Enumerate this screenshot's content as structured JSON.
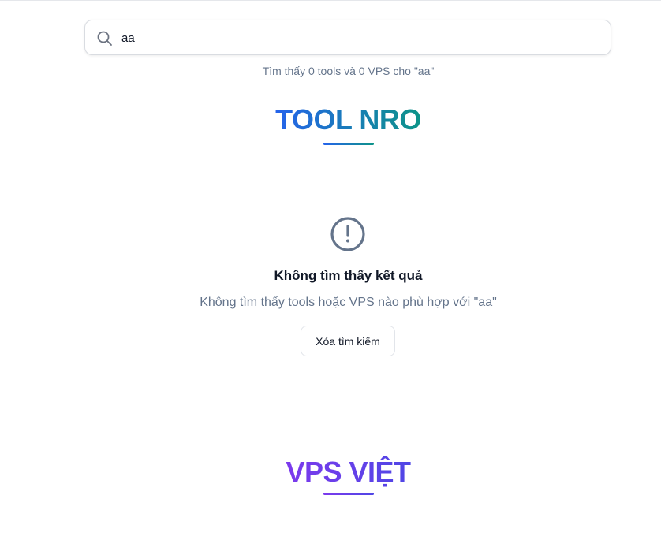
{
  "search": {
    "value": "aa",
    "icon": "search-icon"
  },
  "results_summary": "Tìm thấy 0 tools và 0 VPS cho \"aa\"",
  "tool_section": {
    "title": "TOOL NRO",
    "accent_from": "#2563eb",
    "accent_to": "#0d9488"
  },
  "empty_state": {
    "icon": "alert-circle-icon",
    "title": "Không tìm thấy kết quả",
    "description": "Không tìm thấy tools hoặc VPS nào phù hợp với \"aa\"",
    "clear_button_label": "Xóa tìm kiếm"
  },
  "vps_section": {
    "title": "VPS VIỆT",
    "accent_from": "#7c3aed",
    "accent_to": "#4f46e5"
  }
}
